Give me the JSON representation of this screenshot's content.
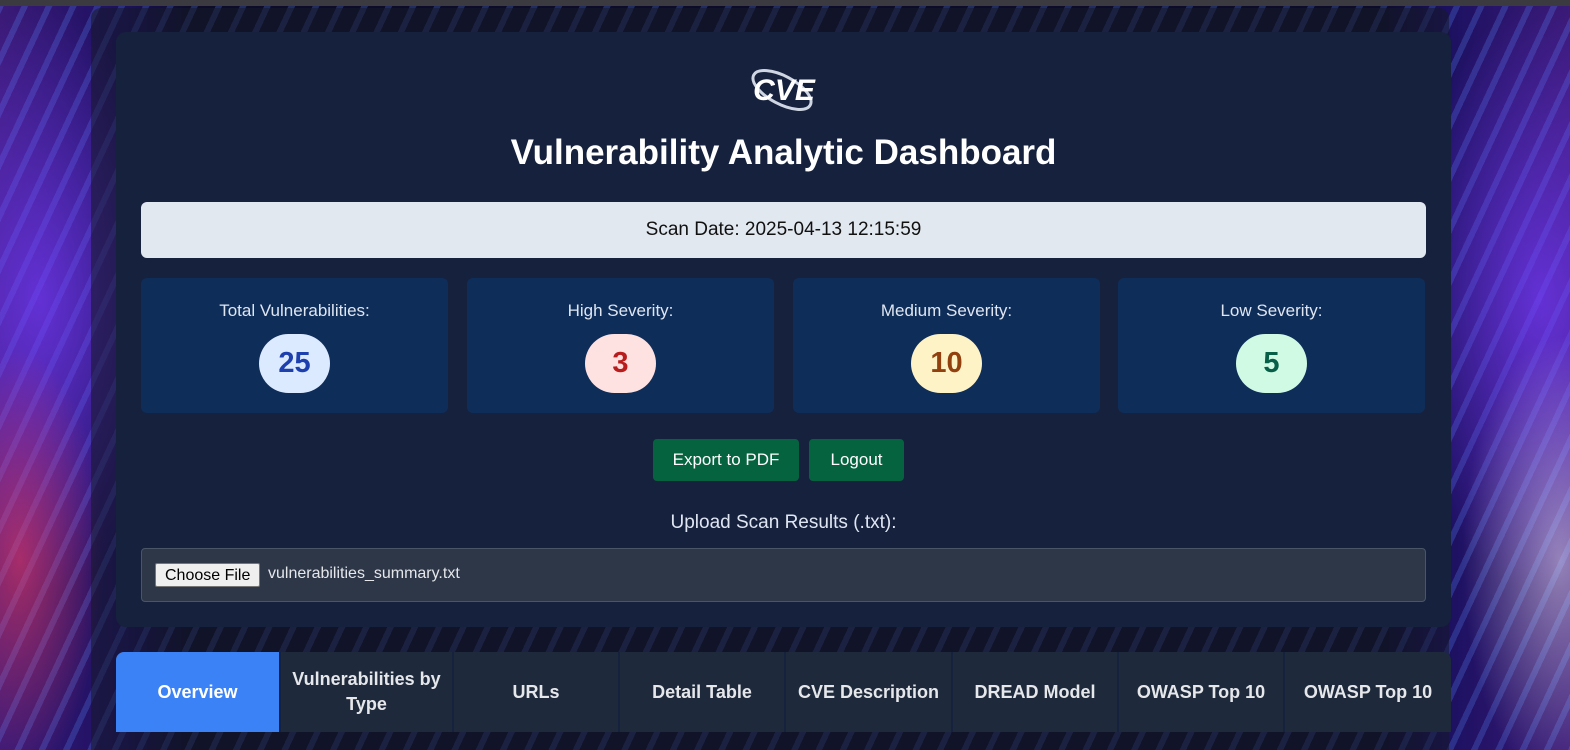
{
  "header": {
    "logo_text": "CVE",
    "title": "Vulnerability Analytic Dashboard"
  },
  "scan": {
    "date_text": "Scan Date: 2025-04-13 12:15:59"
  },
  "stats": [
    {
      "label": "Total Vulnerabilities:",
      "value": "25",
      "bg": "#dbeafe",
      "fg": "#1e40af"
    },
    {
      "label": "High Severity:",
      "value": "3",
      "bg": "#fee2e2",
      "fg": "#b91c1c"
    },
    {
      "label": "Medium Severity:",
      "value": "10",
      "bg": "#fef3c7",
      "fg": "#92400e"
    },
    {
      "label": "Low Severity:",
      "value": "5",
      "bg": "#d1fae5",
      "fg": "#065f46"
    }
  ],
  "actions": {
    "export_label": "Export to PDF",
    "logout_label": "Logout"
  },
  "upload": {
    "label": "Upload Scan Results (.txt):",
    "choose_label": "Choose File",
    "file_name": "vulnerabilities_summary.txt"
  },
  "tabs": [
    {
      "label": "Overview",
      "active": true
    },
    {
      "label": "Vulnerabilities by Type",
      "active": false
    },
    {
      "label": "URLs",
      "active": false
    },
    {
      "label": "Detail Table",
      "active": false
    },
    {
      "label": "CVE Description",
      "active": false
    },
    {
      "label": "DREAD Model",
      "active": false
    },
    {
      "label": "OWASP Top 10",
      "active": false
    },
    {
      "label": "OWASP Top 10",
      "active": false
    }
  ],
  "colors": {
    "accent": "#3b82f6",
    "button": "#06633f",
    "card": "#16213d",
    "stat_card": "#0f2d59"
  }
}
